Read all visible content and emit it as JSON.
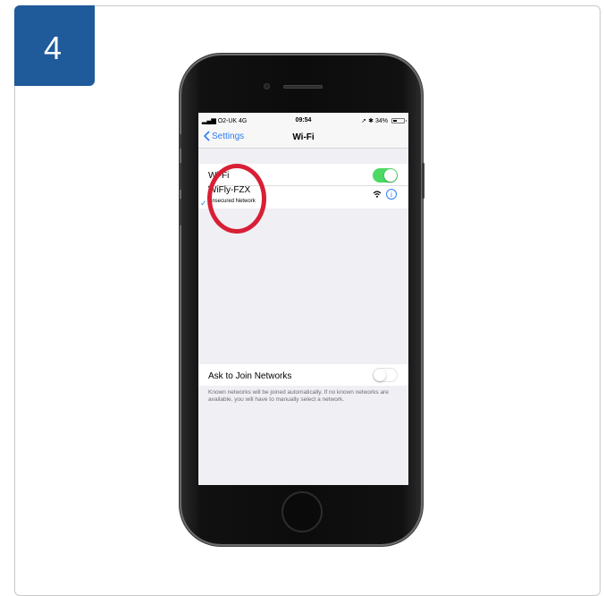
{
  "step": {
    "number": "4"
  },
  "statusbar": {
    "carrier": "O2-UK 4G",
    "time": "09:54",
    "battery_pct": "34%",
    "battery_level": 0.34
  },
  "navbar": {
    "back_label": "Settings",
    "title": "Wi-Fi"
  },
  "wifi_toggle": {
    "label": "Wi-Fi",
    "state": "on"
  },
  "network": {
    "name": "WiFly-FZX",
    "subtitle": "Unsecured Network",
    "connected": true
  },
  "ask_to_join": {
    "label": "Ask to Join Networks",
    "state": "off",
    "description": "Known networks will be joined automatically. If no known networks are available, you will have to manually select a network."
  },
  "colors": {
    "accent": "#2f7cf6",
    "toggle_on": "#4cd964",
    "highlight_circle": "#d81f35",
    "badge": "#1f5a9a"
  }
}
